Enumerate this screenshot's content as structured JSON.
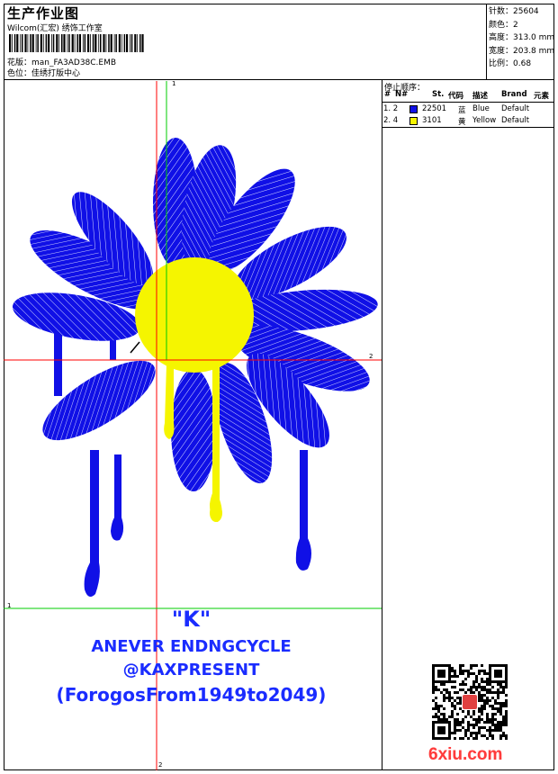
{
  "header": {
    "title": "生产作业图",
    "company": "Wilcom(汇宏) 绣饰工作室",
    "design_label": "花版：",
    "design_file": "man_FA3AD38C.EMB",
    "colorway_label": "色位：",
    "colorway_value": "佳绣打版中心"
  },
  "stats": {
    "stitches_label": "针数：",
    "stitches": "25604",
    "colors_label": "颜色：",
    "colors": "2",
    "height_label": "高度：",
    "height": "313.0 mm",
    "width_label": "宽度：",
    "width": "203.8 mm",
    "ratio_label": "比例：",
    "ratio": "0.68"
  },
  "threads": {
    "title": "停止顺序：",
    "headers": {
      "num": "#",
      "n": "N#",
      "st": "St.",
      "code": "代码",
      "desc": "描述",
      "brand": "Brand",
      "element": "元素"
    },
    "rows": [
      {
        "index": "1. 2",
        "color": "#1010e6",
        "code": "22501",
        "cn": "蓝",
        "desc": "Blue",
        "brand": "Default"
      },
      {
        "index": "2. 4",
        "color": "#f5f500",
        "code": "3101",
        "cn": "黄",
        "desc": "Yellow",
        "brand": "Default"
      }
    ]
  },
  "guides": {
    "v_top": "1",
    "h_right": "2",
    "h_left": "1",
    "v_bottom": "2"
  },
  "design_text": {
    "line1": "\"K\"",
    "line2": "ANEVER ENDNGCYCLE",
    "line3": "@KAXPRESENT",
    "line4": "(ForogosFrom1949to2049)"
  },
  "watermark": "6xiu.com",
  "colors": {
    "blue": "#1010e6",
    "yellow": "#f5f500",
    "guide_red": "#ff0000",
    "guide_green": "#00cc00"
  }
}
